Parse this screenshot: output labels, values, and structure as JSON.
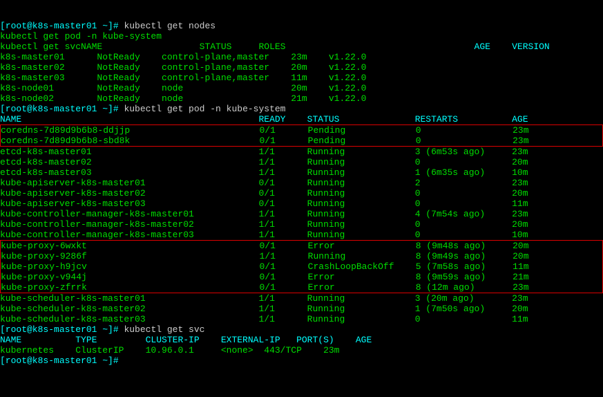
{
  "prompt": "[root@k8s-master01 ~]#",
  "cmd": {
    "nodes": "kubectl get nodes",
    "extra1": "kubectl get pod -n kube-system",
    "extra2": "kubectl get svcNAME",
    "pods": "kubectl get pod -n kube-system",
    "svc": "kubectl get svc"
  },
  "hdr": {
    "nodes_status": "STATUS",
    "nodes_roles": "ROLES",
    "nodes_age": "AGE",
    "nodes_ver": "VERSION",
    "pods_name": "NAME",
    "pods_ready": "READY",
    "pods_status": "STATUS",
    "pods_restarts": "RESTARTS",
    "pods_age": "AGE",
    "svc_name": "NAME",
    "svc_type": "TYPE",
    "svc_cip": "CLUSTER-IP",
    "svc_eip": "EXTERNAL-IP",
    "svc_ports": "PORT(S)",
    "svc_age": "AGE"
  },
  "nodes": [
    {
      "n": "k8s-master01",
      "s": "NotReady",
      "r": "control-plane,master",
      "a": "23m",
      "v": "v1.22.0"
    },
    {
      "n": "k8s-master02",
      "s": "NotReady",
      "r": "control-plane,master",
      "a": "20m",
      "v": "v1.22.0"
    },
    {
      "n": "k8s-master03",
      "s": "NotReady",
      "r": "control-plane,master",
      "a": "11m",
      "v": "v1.22.0"
    },
    {
      "n": "k8s-node01",
      "s": "NotReady",
      "r": "node",
      "a": "20m",
      "v": "v1.22.0"
    },
    {
      "n": "k8s-node02",
      "s": "NotReady",
      "r": "node",
      "a": "21m",
      "v": "v1.22.0"
    }
  ],
  "pods_g1": [
    {
      "n": "coredns-7d89d9b6b8-ddjjp",
      "r": "0/1",
      "s": "Pending",
      "rs": "0",
      "a": "23m"
    },
    {
      "n": "coredns-7d89d9b6b8-sbd8k",
      "r": "0/1",
      "s": "Pending",
      "rs": "0",
      "a": "23m"
    }
  ],
  "pods_g2": [
    {
      "n": "etcd-k8s-master01",
      "r": "1/1",
      "s": "Running",
      "rs": "3 (6m53s ago)",
      "a": "23m"
    },
    {
      "n": "etcd-k8s-master02",
      "r": "1/1",
      "s": "Running",
      "rs": "0",
      "a": "20m"
    },
    {
      "n": "etcd-k8s-master03",
      "r": "1/1",
      "s": "Running",
      "rs": "1 (6m35s ago)",
      "a": "10m"
    },
    {
      "n": "kube-apiserver-k8s-master01",
      "r": "0/1",
      "s": "Running",
      "rs": "2",
      "a": "23m"
    },
    {
      "n": "kube-apiserver-k8s-master02",
      "r": "0/1",
      "s": "Running",
      "rs": "0",
      "a": "20m"
    },
    {
      "n": "kube-apiserver-k8s-master03",
      "r": "0/1",
      "s": "Running",
      "rs": "0",
      "a": "11m"
    },
    {
      "n": "kube-controller-manager-k8s-master01",
      "r": "1/1",
      "s": "Running",
      "rs": "4 (7m54s ago)",
      "a": "23m"
    },
    {
      "n": "kube-controller-manager-k8s-master02",
      "r": "1/1",
      "s": "Running",
      "rs": "0",
      "a": "20m"
    },
    {
      "n": "kube-controller-manager-k8s-master03",
      "r": "1/1",
      "s": "Running",
      "rs": "0",
      "a": "10m"
    }
  ],
  "pods_g3": [
    {
      "n": "kube-proxy-6wxkt",
      "r": "0/1",
      "s": "Error",
      "rs": "8 (9m48s ago)",
      "a": "20m"
    },
    {
      "n": "kube-proxy-9286f",
      "r": "1/1",
      "s": "Running",
      "rs": "8 (9m49s ago)",
      "a": "20m"
    },
    {
      "n": "kube-proxy-h9jcv",
      "r": "0/1",
      "s": "CrashLoopBackOff",
      "rs": "5 (7m58s ago)",
      "a": "11m"
    },
    {
      "n": "kube-proxy-v944j",
      "r": "0/1",
      "s": "Error",
      "rs": "8 (9m59s ago)",
      "a": "21m"
    },
    {
      "n": "kube-proxy-zfrrk",
      "r": "0/1",
      "s": "Error",
      "rs": "8 (12m ago)",
      "a": "23m"
    }
  ],
  "pods_g4": [
    {
      "n": "kube-scheduler-k8s-master01",
      "r": "1/1",
      "s": "Running",
      "rs": "3 (20m ago)",
      "a": "23m"
    },
    {
      "n": "kube-scheduler-k8s-master02",
      "r": "1/1",
      "s": "Running",
      "rs": "1 (7m50s ago)",
      "a": "20m"
    },
    {
      "n": "kube-scheduler-k8s-master03",
      "r": "1/1",
      "s": "Running",
      "rs": "0",
      "a": "11m"
    }
  ],
  "svc": {
    "n": "kubernetes",
    "t": "ClusterIP",
    "cip": "10.96.0.1",
    "eip": "<none>",
    "p": "443/TCP",
    "a": "23m"
  }
}
